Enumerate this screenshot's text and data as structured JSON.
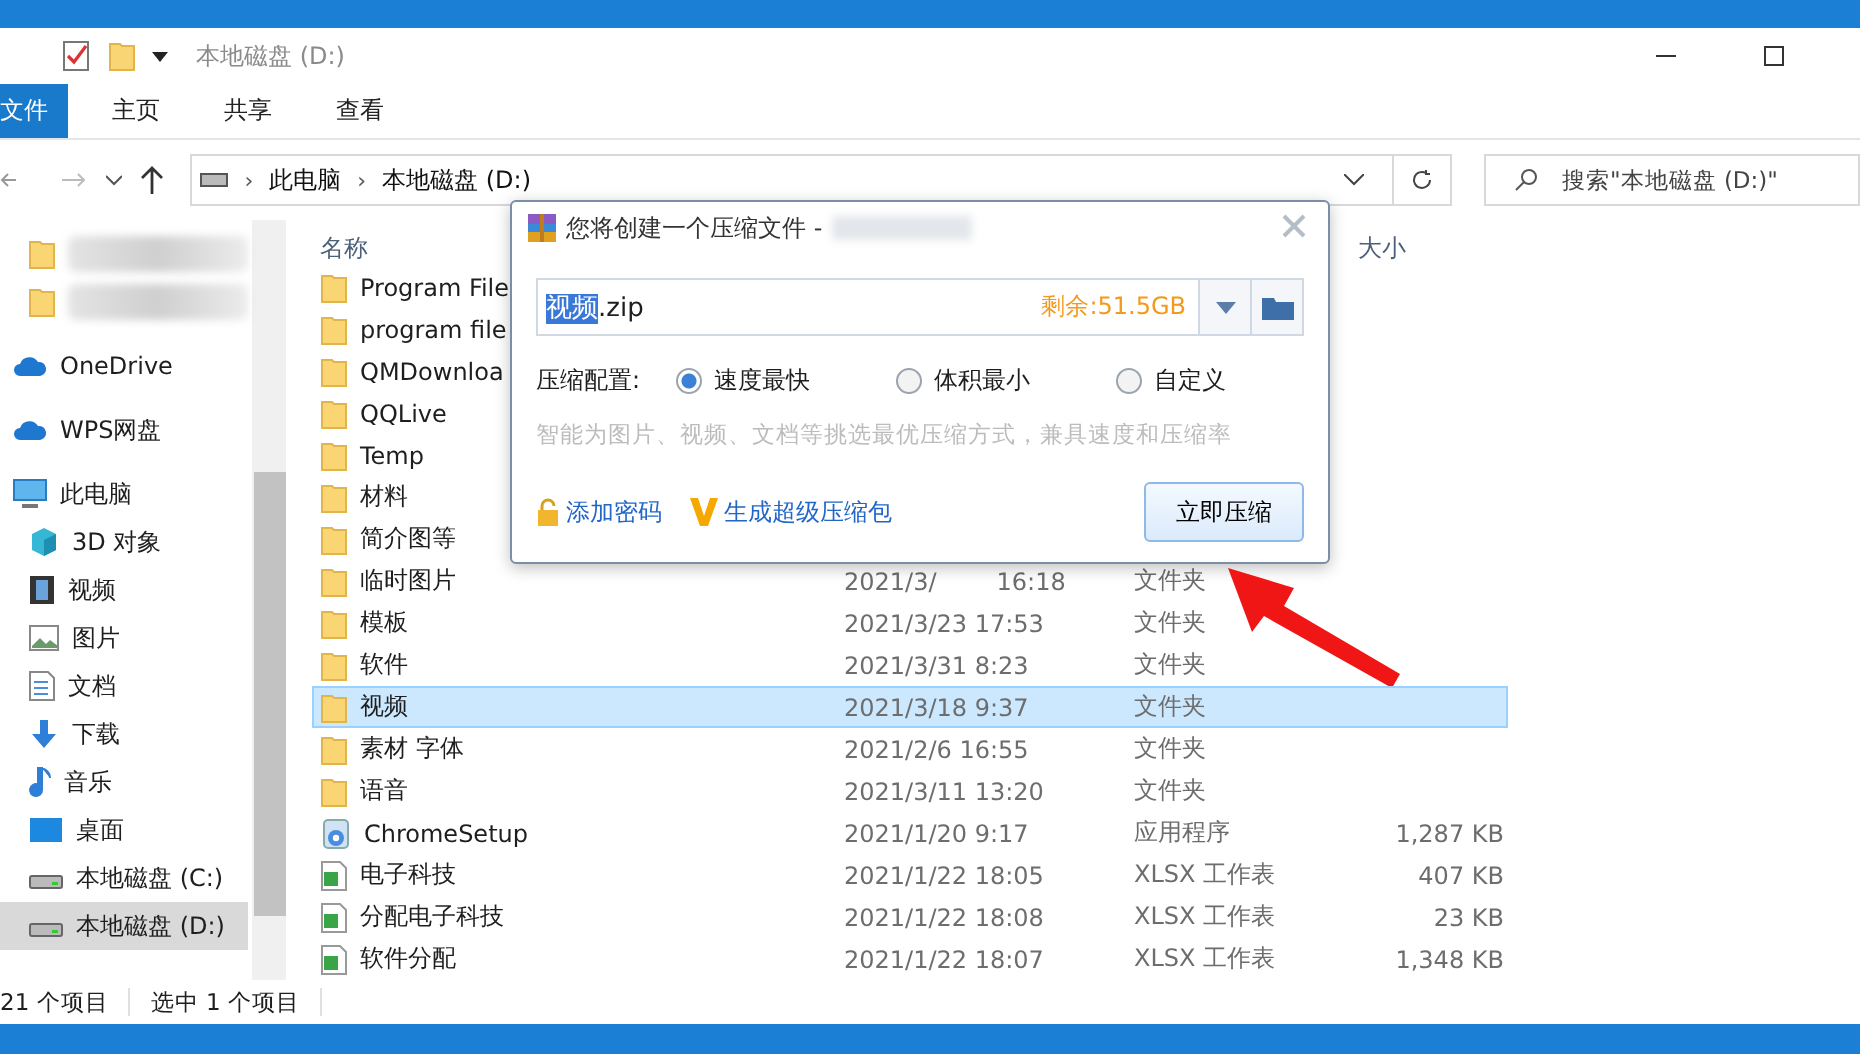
{
  "title_bar": {
    "title": "本地磁盘 (D:)"
  },
  "ribbon_tabs": [
    {
      "label": "文件",
      "selected": true
    },
    {
      "label": "主页",
      "selected": false
    },
    {
      "label": "共享",
      "selected": false
    },
    {
      "label": "查看",
      "selected": false
    }
  ],
  "address": {
    "path": [
      {
        "separator": "›",
        "label": "此电脑"
      },
      {
        "separator": "›",
        "label": "本地磁盘 (D:)"
      }
    ]
  },
  "search": {
    "placeholder": "搜索\"本地磁盘 (D:)\""
  },
  "nav_items": [
    {
      "kind": "blurred"
    },
    {
      "kind": "blurred"
    },
    {
      "kind": "item",
      "label": "OneDrive",
      "selected": false
    },
    {
      "kind": "item",
      "label": "WPS网盘",
      "selected": false
    },
    {
      "kind": "item",
      "label": "此电脑",
      "selected": false,
      "children": [
        {
          "kind": "item",
          "label": "3D 对象",
          "selected": false
        },
        {
          "kind": "item",
          "label": "视频",
          "selected": false
        },
        {
          "kind": "item",
          "label": "图片",
          "selected": false
        },
        {
          "kind": "item",
          "label": "文档",
          "selected": false
        },
        {
          "kind": "item",
          "label": "下载",
          "selected": false
        },
        {
          "kind": "item",
          "label": "音乐",
          "selected": false
        },
        {
          "kind": "item",
          "label": "桌面",
          "selected": false
        },
        {
          "kind": "item",
          "label": "本地磁盘 (C:)",
          "selected": false
        },
        {
          "kind": "item",
          "label": "本地磁盘 (D:)",
          "selected": true
        }
      ]
    }
  ],
  "columns": {
    "name": "名称",
    "size": "大小"
  },
  "files": [
    {
      "name": "Program File",
      "kind": "folder",
      "selected": false
    },
    {
      "name": "program file",
      "kind": "folder",
      "selected": false
    },
    {
      "name": "QMDownloa",
      "kind": "folder",
      "selected": false
    },
    {
      "name": "QQLive",
      "kind": "folder",
      "selected": false
    },
    {
      "name": "Temp",
      "kind": "folder",
      "selected": false
    },
    {
      "name": "材料",
      "kind": "folder",
      "selected": false
    },
    {
      "name": "简介图等",
      "kind": "folder",
      "selected": false
    },
    {
      "name": "临时图片",
      "kind": "folder",
      "date": "2021/3/",
      "time": "16:18",
      "type": "文件夹",
      "selected": false
    },
    {
      "name": "模板",
      "kind": "folder",
      "date": "2021/3/23 17:53",
      "type": "文件夹",
      "selected": false
    },
    {
      "name": "软件",
      "kind": "folder",
      "date": "2021/3/31 8:23",
      "type": "文件夹",
      "selected": false
    },
    {
      "name": "视频",
      "kind": "folder",
      "date": "2021/3/18 9:37",
      "type": "文件夹",
      "selected": true
    },
    {
      "name": "素材 字体",
      "kind": "folder",
      "date": "2021/2/6 16:55",
      "type": "文件夹",
      "selected": false
    },
    {
      "name": "语音",
      "kind": "folder",
      "date": "2021/3/11 13:20",
      "type": "文件夹",
      "selected": false
    },
    {
      "name": "ChromeSetup",
      "kind": "app",
      "date": "2021/1/20 9:17",
      "type": "应用程序",
      "size": "1,287 KB",
      "selected": false
    },
    {
      "name": "电子科技",
      "kind": "sheet",
      "date": "2021/1/22 18:05",
      "type": "XLSX 工作表",
      "size": "407 KB",
      "selected": false
    },
    {
      "name": "分配电子科技",
      "kind": "sheet",
      "date": "2021/1/22 18:08",
      "type": "XLSX 工作表",
      "size": "23 KB",
      "selected": false
    },
    {
      "name": "软件分配",
      "kind": "sheet",
      "date": "2021/1/22 18:07",
      "type": "XLSX 工作表",
      "size": "1,348 KB",
      "selected": false
    }
  ],
  "dialog": {
    "title": "您将创建一个压缩文件 -",
    "filename_selected": "视频",
    "filename_rest": ".zip",
    "free_space": "剩余:51.5GB",
    "config_label": "压缩配置:",
    "options": [
      {
        "label": "速度最快",
        "selected": true
      },
      {
        "label": "体积最小",
        "selected": false
      },
      {
        "label": "自定义",
        "selected": false
      }
    ],
    "hint": "智能为图片、视频、文档等挑选最优压缩方式，兼具速度和压缩率",
    "links": [
      {
        "label": "添加密码"
      },
      {
        "label": "生成超级压缩包"
      }
    ],
    "button": "立即压缩"
  },
  "status_bar": {
    "count": "21 个项目",
    "selection": "选中 1 个项目"
  }
}
